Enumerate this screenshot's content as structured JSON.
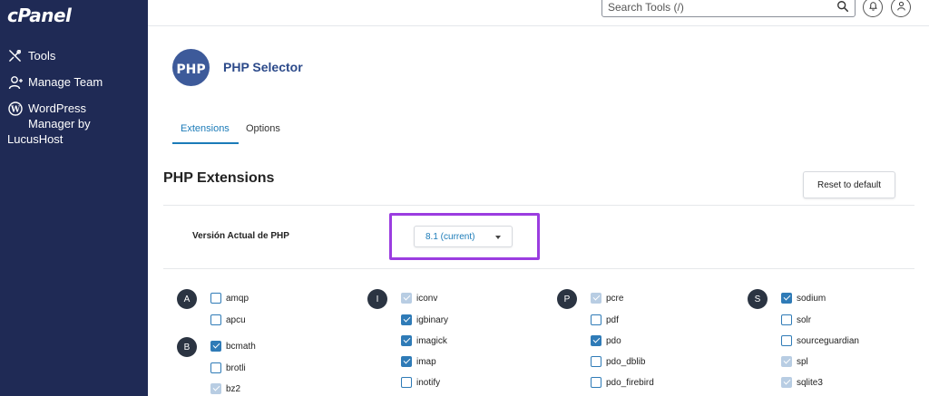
{
  "sidebar": {
    "logo": "cPanel",
    "items": [
      {
        "label": "Tools"
      },
      {
        "label": "Manage Team"
      },
      {
        "label_line1": "WordPress",
        "label_line2": "Manager by",
        "label_line3": "LucusHost"
      }
    ]
  },
  "topbar": {
    "search_placeholder": "Search Tools (/)"
  },
  "header": {
    "logo_text": "PHP",
    "title": "PHP Selector"
  },
  "tabs": [
    {
      "label": "Extensions",
      "active": true
    },
    {
      "label": "Options",
      "active": false
    }
  ],
  "section": {
    "title": "PHP Extensions",
    "reset_label": "Reset to default"
  },
  "version": {
    "label": "Versión Actual de PHP",
    "selected": "8.1 (current)"
  },
  "colors": {
    "sidebar_bg": "#1f2a55",
    "accent": "#1b7bb8",
    "highlight": "#9b3de0",
    "checkbox": "#2f7bb7",
    "checkbox_disabled": "#b8cde3"
  },
  "groups": [
    {
      "letter": "A",
      "items": [
        {
          "name": "amqp",
          "state": "unchecked"
        },
        {
          "name": "apcu",
          "state": "unchecked"
        }
      ]
    },
    {
      "letter": "B",
      "items": [
        {
          "name": "bcmath",
          "state": "checked"
        },
        {
          "name": "brotli",
          "state": "unchecked"
        },
        {
          "name": "bz2",
          "state": "disabled"
        }
      ]
    },
    {
      "letter": "I",
      "items": [
        {
          "name": "iconv",
          "state": "disabled"
        },
        {
          "name": "igbinary",
          "state": "checked"
        },
        {
          "name": "imagick",
          "state": "checked"
        },
        {
          "name": "imap",
          "state": "checked"
        },
        {
          "name": "inotify",
          "state": "unchecked"
        }
      ]
    },
    {
      "letter": "P",
      "items": [
        {
          "name": "pcre",
          "state": "disabled"
        },
        {
          "name": "pdf",
          "state": "unchecked"
        },
        {
          "name": "pdo",
          "state": "checked"
        },
        {
          "name": "pdo_dblib",
          "state": "unchecked"
        },
        {
          "name": "pdo_firebird",
          "state": "unchecked"
        }
      ]
    },
    {
      "letter": "S",
      "items": [
        {
          "name": "sodium",
          "state": "checked"
        },
        {
          "name": "solr",
          "state": "unchecked"
        },
        {
          "name": "sourceguardian",
          "state": "unchecked"
        },
        {
          "name": "spl",
          "state": "disabled"
        },
        {
          "name": "sqlite3",
          "state": "disabled"
        }
      ]
    }
  ]
}
